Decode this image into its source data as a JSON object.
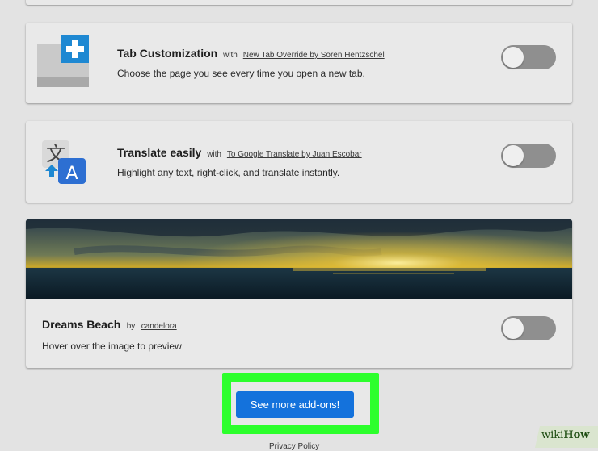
{
  "addons": {
    "tab_customization": {
      "title": "Tab Customization",
      "by": "with",
      "author": "New Tab Override by Sören Hentzschel",
      "description": "Choose the page you see every time you open a new tab.",
      "enabled": false,
      "icon": "tab-plus-icon"
    },
    "translate": {
      "title": "Translate easily",
      "by": "with",
      "author": "To Google Translate by Juan Escobar",
      "description": "Highlight any text, right-click, and translate instantly.",
      "enabled": false,
      "icon": "translate-icon"
    },
    "dreams_beach": {
      "title": "Dreams Beach",
      "by": "by",
      "author": "candelora",
      "description": "Hover over the image to preview",
      "enabled": false,
      "image": "sunset-beach-theme-preview"
    }
  },
  "footer": {
    "more_button_label": "See more add-ons!",
    "privacy_label": "Privacy Policy"
  },
  "watermark": {
    "wiki": "wiki",
    "how": "How"
  },
  "colors": {
    "page_background": "#e3e3e3",
    "card_background": "#e9e9e9",
    "toggle_off": "#8f8f8f",
    "button_blue": "#1472dc",
    "highlight_green": "#2cff2c",
    "icon_blue": "#1e88d2",
    "translate_blue": "#2d6fd2"
  }
}
